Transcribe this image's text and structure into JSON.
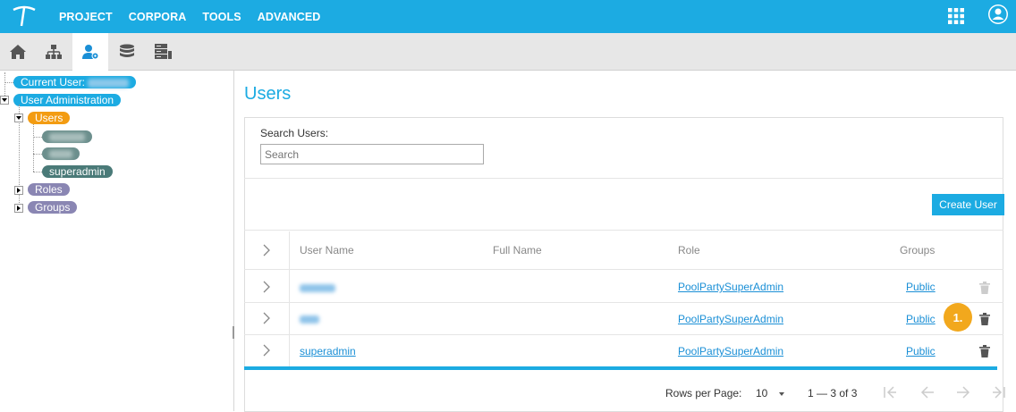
{
  "topbar": {
    "nav": [
      "PROJECT",
      "CORPORA",
      "TOOLS",
      "ADVANCED"
    ],
    "icons": [
      "logo-icon",
      "apps-grid-icon",
      "user-account-icon"
    ]
  },
  "toolbar": {
    "icons": [
      "home-icon",
      "hierarchy-icon",
      "user-admin-icon",
      "database-icon",
      "server-icon"
    ],
    "active": "user-admin-icon"
  },
  "tree": {
    "current_user_label": "Current User:",
    "user_admin_label": "User Administration",
    "users_label": "Users",
    "users": [
      "superadmin"
    ],
    "roles_label": "Roles",
    "groups_label": "Groups"
  },
  "main": {
    "title": "Users",
    "search_label": "Search Users:",
    "search_placeholder": "Search",
    "create_button": "Create User",
    "columns": [
      "User Name",
      "Full Name",
      "Role",
      "Groups"
    ],
    "rows": [
      {
        "username": "",
        "role": "PoolPartySuperAdmin",
        "group": "Public"
      },
      {
        "username": "",
        "role": "PoolPartySuperAdmin",
        "group": "Public"
      },
      {
        "username": "superadmin",
        "role": "PoolPartySuperAdmin",
        "group": "Public"
      }
    ],
    "badge": "1.",
    "rows_per_page_label": "Rows per Page:",
    "rows_per_page_value": "10",
    "range_text": "1 — 3 of 3"
  },
  "colors": {
    "brand": "#1cabe2",
    "users_node": "#f39c12",
    "roles_node": "#8a86b3",
    "superadmin_node": "#4a7a78",
    "badge": "#f2a81d"
  }
}
